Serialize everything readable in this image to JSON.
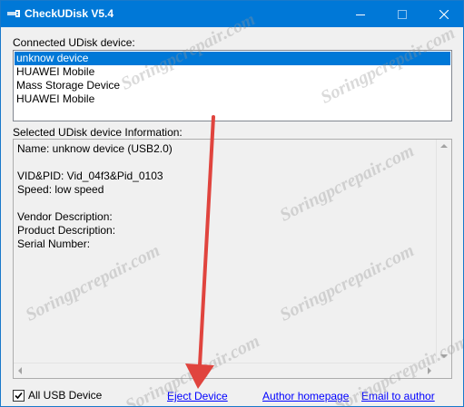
{
  "window": {
    "title": "CheckUDisk V5.4",
    "icon": "usb-icon",
    "controls": [
      "minimize-icon",
      "maximize-icon",
      "close-icon"
    ]
  },
  "connected": {
    "label": "Connected UDisk device:",
    "items": [
      {
        "label": "unknow device",
        "selected": true
      },
      {
        "label": "HUAWEI Mobile",
        "selected": false
      },
      {
        "label": "Mass Storage Device",
        "selected": false
      },
      {
        "label": "HUAWEI Mobile",
        "selected": false
      }
    ]
  },
  "info": {
    "label": "Selected UDisk device Information:",
    "lines": [
      "Name: unknow device  (USB2.0)",
      "",
      "VID&PID: Vid_04f3&Pid_0103",
      "Speed: low speed",
      "",
      "Vendor Description:",
      "Product Description:",
      "Serial Number:"
    ]
  },
  "footer": {
    "all_usb_label": "All USB Device",
    "all_usb_checked": true,
    "eject_label": "Eject Device",
    "author_label": "Author homepage",
    "email_label": "Email to author"
  },
  "watermark_text": "Soringpcrepair.com",
  "colors": {
    "titlebar": "#0078d7",
    "selection": "#0078d7",
    "link": "#0000ff",
    "annotation_arrow": "#e0443e"
  }
}
